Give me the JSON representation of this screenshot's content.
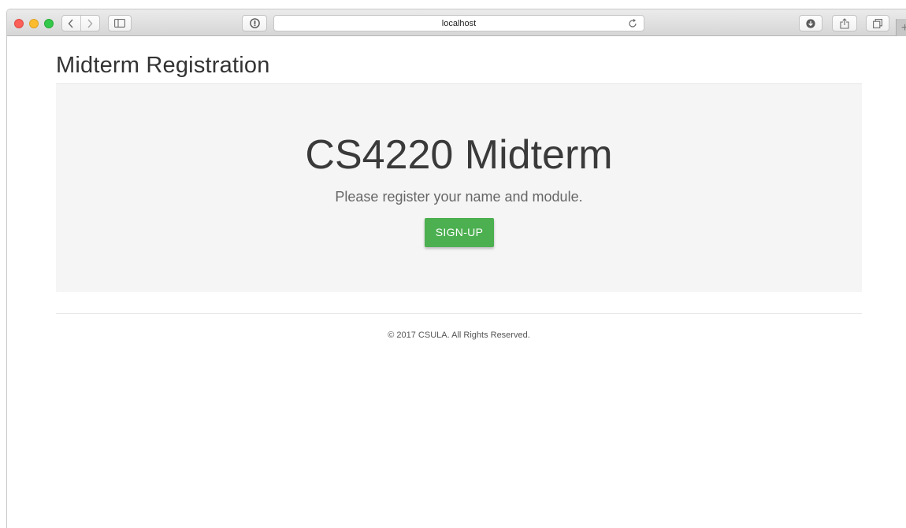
{
  "browser": {
    "address_text": "localhost",
    "new_tab_glyph": "+",
    "icons": {
      "back": "chevron-left-icon",
      "forward": "chevron-right-icon",
      "sidebar": "sidebar-icon",
      "privacy": "shield-icon",
      "reload": "reload-icon",
      "download": "download-icon",
      "share": "share-icon",
      "tabs": "tabs-icon"
    }
  },
  "page": {
    "title": "Midterm Registration",
    "jumbotron": {
      "heading": "CS4220 Midterm",
      "lead": "Please register your name and module.",
      "button_label": "SIGN-UP",
      "button_color": "#4caf50"
    },
    "footer": "© 2017 CSULA. All Rights Reserved."
  }
}
